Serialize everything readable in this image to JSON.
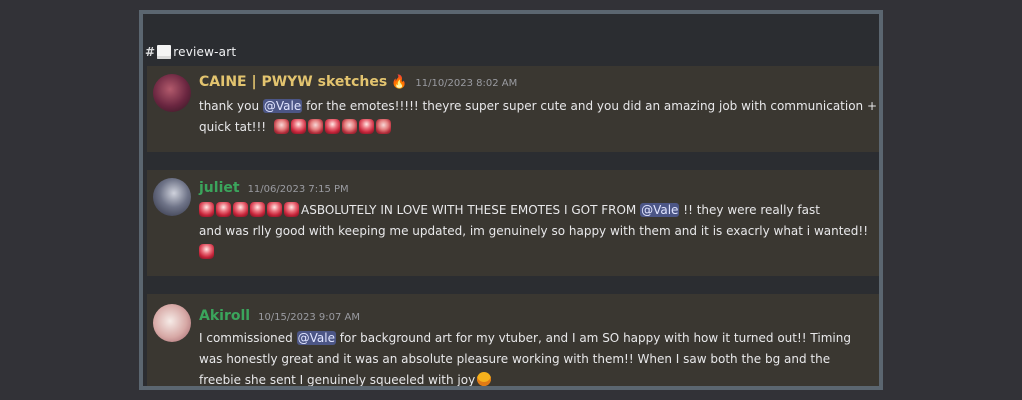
{
  "channel": {
    "hash": "#",
    "icon": "page-icon",
    "name": "review-art"
  },
  "messages": [
    {
      "username": "CAINE | PWYW sketches",
      "badge_icon": "fire-icon",
      "timestamp": "11/10/2023 8:02 AM",
      "line1_pre": "thank you ",
      "mention": "@Vale",
      "line1_post": " for the emotes!!!!! theyre super super cute and you did an amazing job with communication +",
      "line2": "quick tat!!!",
      "emote_count": 7
    },
    {
      "username": "juliet",
      "timestamp": "11/06/2023 7:15 PM",
      "line1_pre": "ASBOLUTELY IN LOVE WITH THESE EMOTES I GOT FROM ",
      "mention": "@Vale",
      "line1_post": " !! they were really fast",
      "line2": "and was rlly good with keeping me updated, im genuinely so happy with them and it is exacrly what i wanted!!",
      "emote_count": 6
    },
    {
      "username": "Akiroll",
      "timestamp": "10/15/2023 9:07 AM",
      "line1_pre": "I commissioned ",
      "mention": "@Vale",
      "line1_post": " for background art for my vtuber, and I am SO happy with how it turned out!! Timing",
      "line2": "was honestly great and it was an absolute pleasure working with them!! When I saw both the bg and the",
      "line3": "freebie she sent I genuinely  squeeled with joy",
      "end_icon": "grinning-face-icon"
    }
  ],
  "colors": {
    "username_caine": "#e3c46f",
    "username_green": "#3ba55c",
    "mention_bg": "#4c5686",
    "message_bg": "#3a3731"
  }
}
